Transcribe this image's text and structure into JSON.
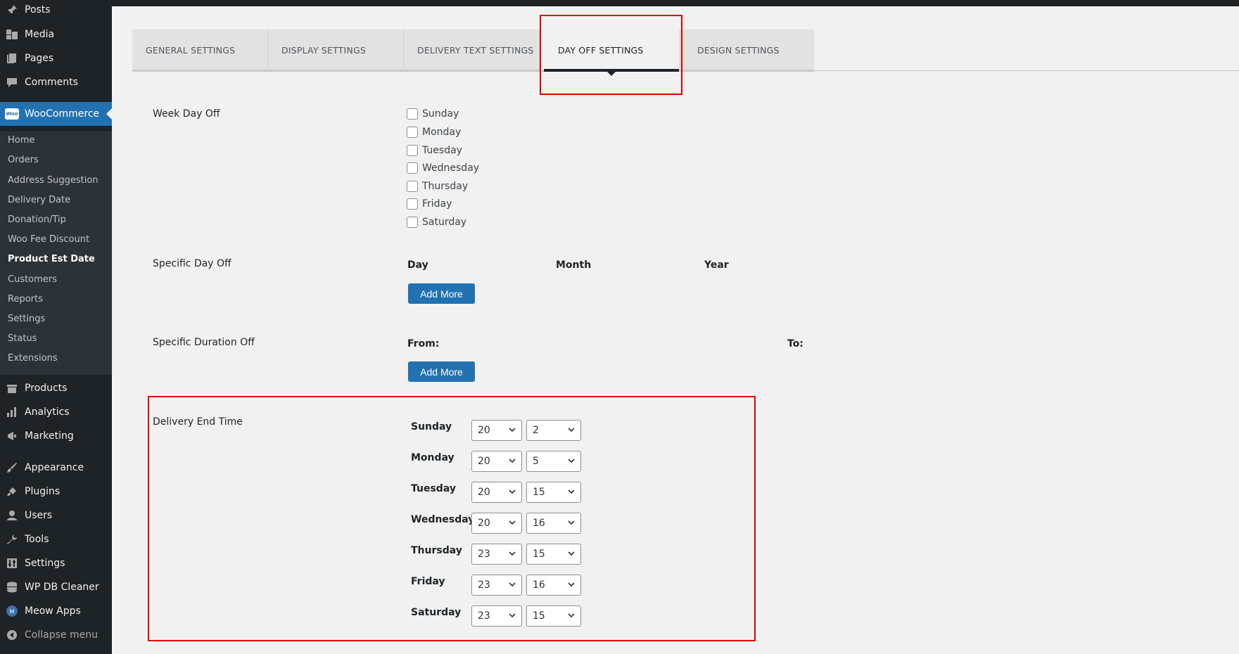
{
  "sidebar": {
    "items_top": [
      {
        "label": "Posts",
        "icon": "pin-icon"
      },
      {
        "label": "Media",
        "icon": "media-icon"
      },
      {
        "label": "Pages",
        "icon": "pages-icon"
      },
      {
        "label": "Comments",
        "icon": "comments-icon"
      }
    ],
    "woocommerce": {
      "label": "WooCommerce",
      "logo": "Woo"
    },
    "woo_submenu": [
      "Home",
      "Orders",
      "Address Suggestion",
      "Delivery Date",
      "Donation/Tip",
      "Woo Fee Discount",
      "Product Est Date",
      "Customers",
      "Reports",
      "Settings",
      "Status",
      "Extensions"
    ],
    "woo_current": "Product Est Date",
    "items_bottom": [
      {
        "label": "Products",
        "icon": "products-icon"
      },
      {
        "label": "Analytics",
        "icon": "analytics-icon"
      },
      {
        "label": "Marketing",
        "icon": "marketing-icon"
      },
      {
        "label": "Appearance",
        "icon": "appearance-icon"
      },
      {
        "label": "Plugins",
        "icon": "plugins-icon"
      },
      {
        "label": "Users",
        "icon": "users-icon"
      },
      {
        "label": "Tools",
        "icon": "tools-icon"
      },
      {
        "label": "Settings",
        "icon": "settings-icon"
      },
      {
        "label": "WP DB Cleaner",
        "icon": "database-icon"
      },
      {
        "label": "Meow Apps",
        "icon": "meow-icon"
      },
      {
        "label": "Collapse menu",
        "icon": "collapse-icon"
      }
    ]
  },
  "tabs": [
    {
      "label": "GENERAL SETTINGS"
    },
    {
      "label": "DISPLAY SETTINGS"
    },
    {
      "label": "DELIVERY TEXT SETTINGS"
    },
    {
      "label": "DAY OFF SETTINGS",
      "active": true
    },
    {
      "label": "DESIGN SETTINGS"
    }
  ],
  "week_day_off": {
    "label": "Week Day Off",
    "days": [
      "Sunday",
      "Monday",
      "Tuesday",
      "Wednesday",
      "Thursday",
      "Friday",
      "Saturday"
    ]
  },
  "specific_day_off": {
    "label": "Specific Day Off",
    "columns": [
      "Day",
      "Month",
      "Year"
    ],
    "button": "Add More"
  },
  "specific_duration_off": {
    "label": "Specific Duration Off",
    "from_label": "From:",
    "to_label": "To:",
    "button": "Add More"
  },
  "delivery_end_time": {
    "label": "Delivery End Time",
    "rows": [
      {
        "day": "Sunday",
        "hour": "20",
        "minute": "2"
      },
      {
        "day": "Monday",
        "hour": "20",
        "minute": "5"
      },
      {
        "day": "Tuesday",
        "hour": "20",
        "minute": "15"
      },
      {
        "day": "Wednesday",
        "hour": "20",
        "minute": "16"
      },
      {
        "day": "Thursday",
        "hour": "23",
        "minute": "15"
      },
      {
        "day": "Friday",
        "hour": "23",
        "minute": "16"
      },
      {
        "day": "Saturday",
        "hour": "23",
        "minute": "15"
      }
    ]
  },
  "colors": {
    "sidebar_bg": "#1d2327",
    "submenu_bg": "#2c3338",
    "accent_blue": "#2271b1",
    "highlight_red": "#e00000"
  }
}
